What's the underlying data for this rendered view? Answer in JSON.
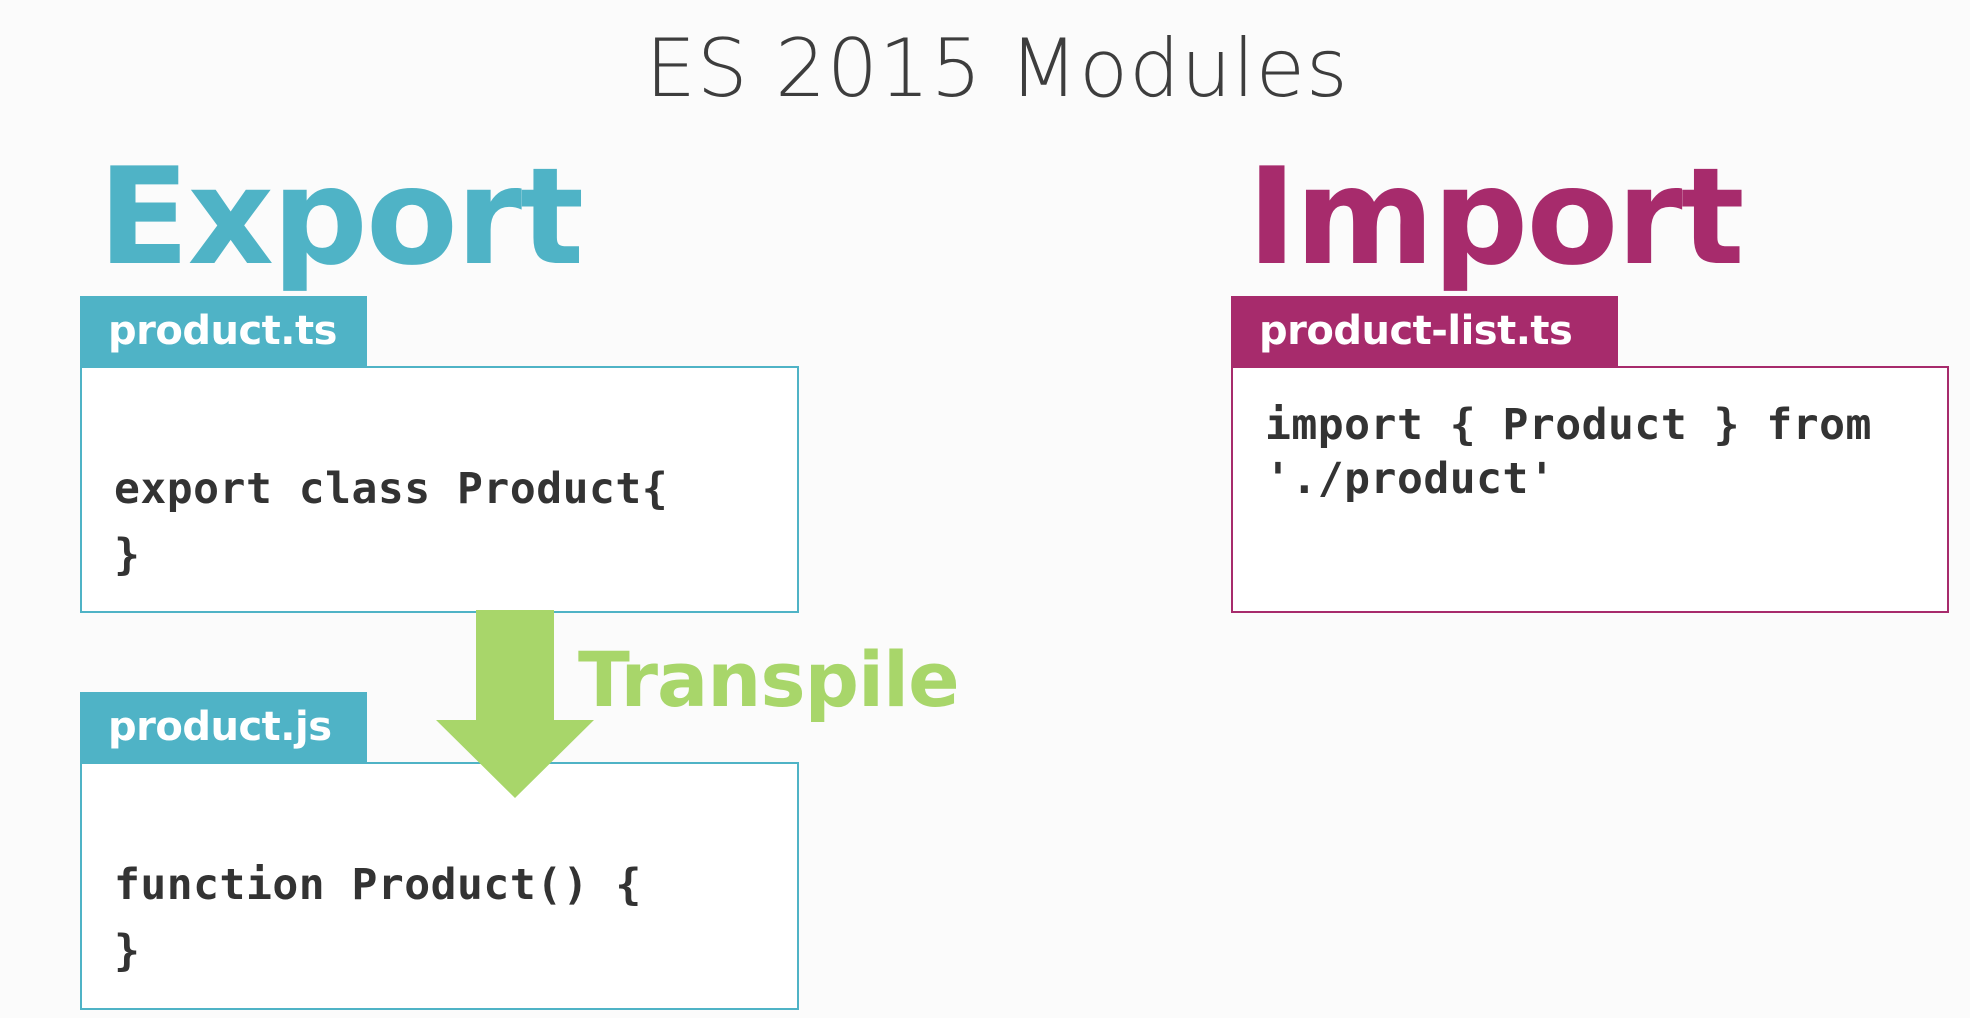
{
  "title": "ES 2015 Modules",
  "export": {
    "heading": "Export",
    "source_file": {
      "name": "product.ts",
      "code": [
        "export class Product{",
        "}"
      ]
    },
    "output_file": {
      "name": "product.js",
      "code": [
        "function Product() {",
        "}"
      ]
    },
    "transpile_label": "Transpile"
  },
  "import": {
    "heading": "Import",
    "file": {
      "name": "product-list.ts",
      "code": [
        "import { Product } from",
        "'./product'"
      ]
    }
  },
  "colors": {
    "export_accent": "#4fb3c6",
    "import_accent": "#a72b6c",
    "transpile_accent": "#a8d66a",
    "title_text": "#3d3d3d",
    "code_text": "#333333"
  },
  "icons": {
    "transpile_arrow": "down-arrow-icon"
  }
}
